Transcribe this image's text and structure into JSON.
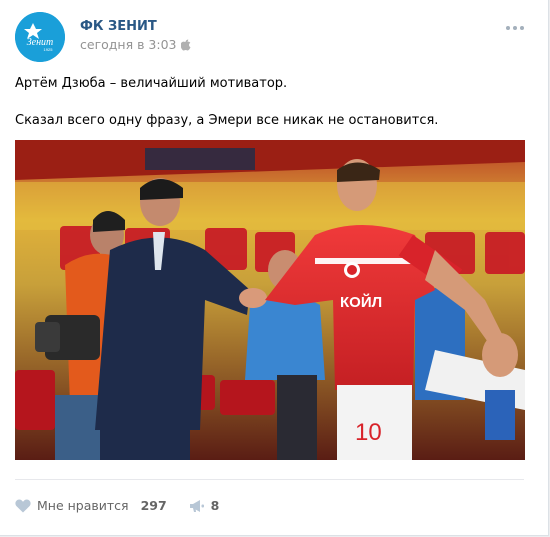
{
  "post": {
    "author": "ФК ЗЕНИТ",
    "time": "сегодня в 3:03",
    "avatar": {
      "logo_text": "Зенит",
      "year": "1925",
      "color": "#1a9fd9"
    },
    "text_line1": "Артём Дзюба – величайший мотиватор.",
    "text_line2": "Сказал всего одну фразу, а Эмери все никак не остановится.",
    "photo": {
      "description_alt": "Футболисты пожимают руки",
      "jersey_sponsor": "ЛУКОЙЛ",
      "shirt_text": "КОЙЛ",
      "number": "10"
    }
  },
  "actions": {
    "like_label": "Мне нравится",
    "like_count": "297",
    "share_count": "8"
  },
  "colors": {
    "accent": "#2a5885",
    "muted": "#939393",
    "spartak_red": "#d8232a"
  }
}
